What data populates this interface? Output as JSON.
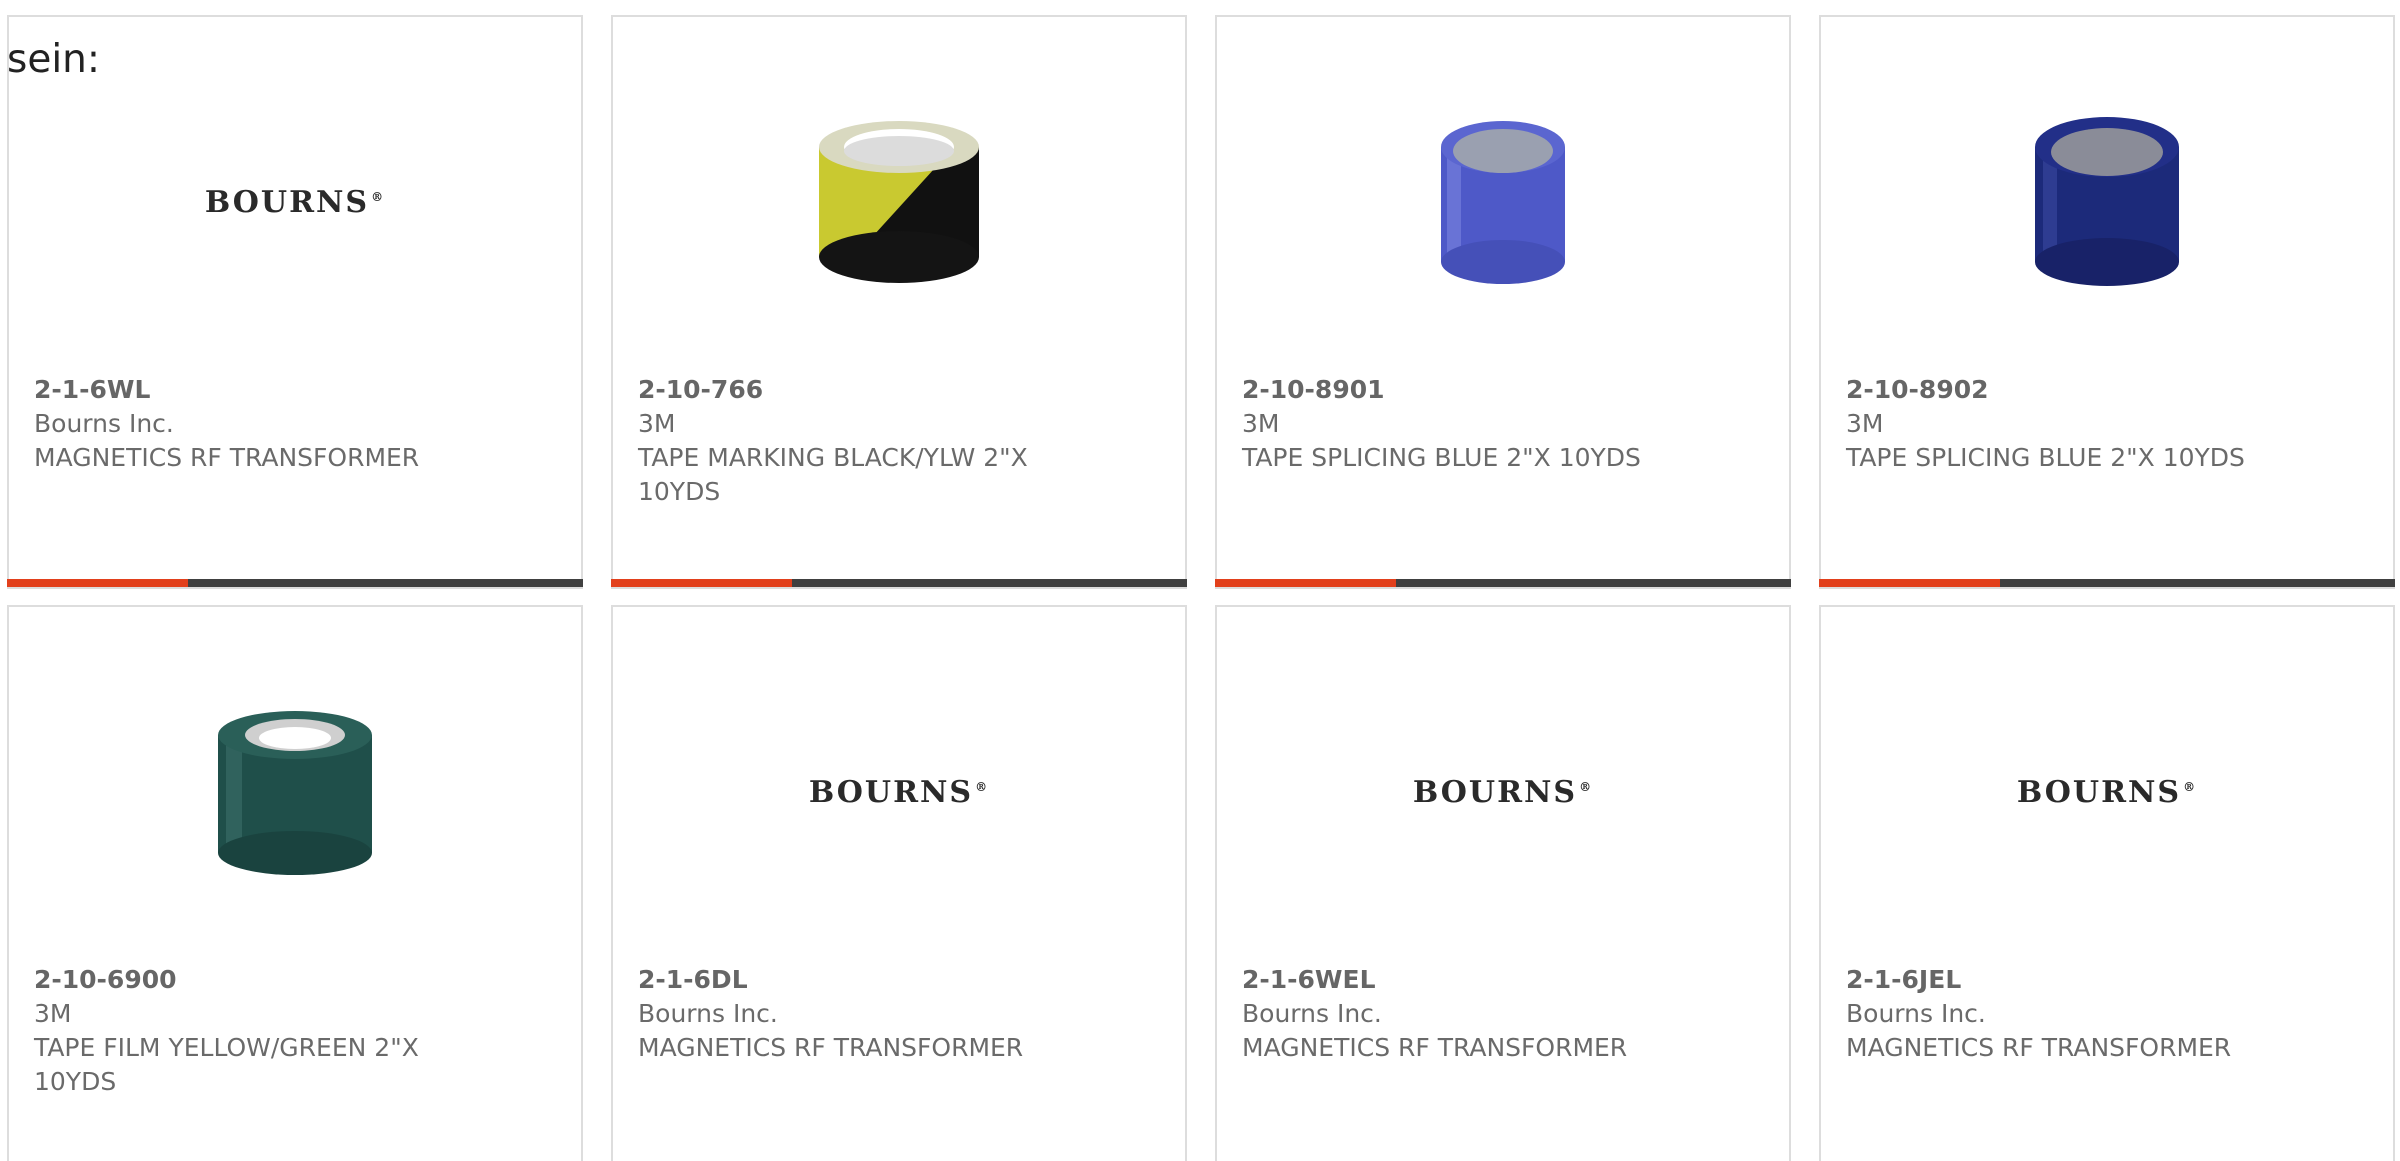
{
  "intro_text": "sein:",
  "brand_logo_text": "BOURNS",
  "brand_logo_mark": "®",
  "accent_color": "#e2401c",
  "bar_track_color": "#404040",
  "bar_fill_fraction": 0.315,
  "cards": [
    {
      "part_number": "2-1-6WL",
      "manufacturer": "Bourns Inc.",
      "description": "MAGNETICS RF TRANSFORMER",
      "image": "bourns-logo"
    },
    {
      "part_number": "2-10-766",
      "manufacturer": "3M",
      "description": "TAPE MARKING BLACK/YLW 2\"X 10YDS",
      "image": "tape-roll-black-yellow"
    },
    {
      "part_number": "2-10-8901",
      "manufacturer": "3M",
      "description": "TAPE SPLICING BLUE 2\"X 10YDS",
      "image": "tape-roll-blue"
    },
    {
      "part_number": "2-10-8902",
      "manufacturer": "3M",
      "description": "TAPE SPLICING BLUE 2\"X 10YDS",
      "image": "tape-roll-dark-blue"
    },
    {
      "part_number": "2-10-6900",
      "manufacturer": "3M",
      "description": "TAPE FILM YELLOW/GREEN 2\"X 10YDS",
      "image": "tape-roll-green"
    },
    {
      "part_number": "2-1-6DL",
      "manufacturer": "Bourns Inc.",
      "description": "MAGNETICS RF TRANSFORMER",
      "image": "bourns-logo"
    },
    {
      "part_number": "2-1-6WEL",
      "manufacturer": "Bourns Inc.",
      "description": "MAGNETICS RF TRANSFORMER",
      "image": "bourns-logo"
    },
    {
      "part_number": "2-1-6JEL",
      "manufacturer": "Bourns Inc.",
      "description": "MAGNETICS RF TRANSFORMER",
      "image": "bourns-logo"
    }
  ]
}
